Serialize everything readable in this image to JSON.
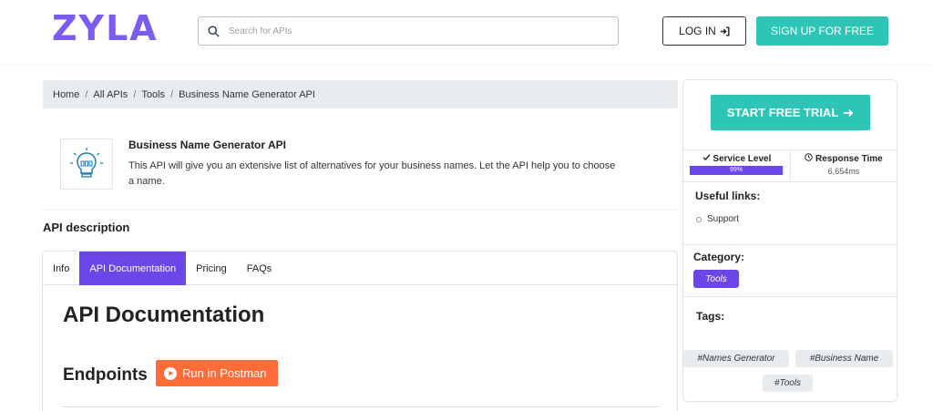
{
  "header": {
    "logo": "ZYLA",
    "search": {
      "placeholder": "Search for APIs",
      "value": ""
    },
    "login_label": "LOG IN",
    "signup_label": "SIGN UP FOR FREE"
  },
  "breadcrumb": [
    "Home",
    "All APIs",
    "Tools",
    "Business Name Generator API"
  ],
  "api": {
    "title": "Business Name Generator API",
    "description": "This API will give you an extensive list of alternatives for your business names. Let the API help you to choose a name."
  },
  "section_title": "API description",
  "tabs": [
    {
      "label": "Info",
      "active": false
    },
    {
      "label": "API Documentation",
      "active": true
    },
    {
      "label": "Pricing",
      "active": false
    },
    {
      "label": "FAQs",
      "active": false
    }
  ],
  "doc": {
    "heading": "API Documentation",
    "endpoints_heading": "Endpoints",
    "postman_label": "Run in Postman"
  },
  "sidebar": {
    "trial_label": "START FREE TRIAL",
    "service_level": {
      "label": "Service Level",
      "value": "99%",
      "fraction": 0.99
    },
    "response_time": {
      "label": "Response Time",
      "value": "6,654ms"
    },
    "useful_links_heading": "Useful links:",
    "links": [
      "Support"
    ],
    "category_heading": "Category:",
    "category": "Tools",
    "tags_heading": "Tags:",
    "tags": [
      "#Names Generator",
      "#Business Name",
      "#Tools"
    ]
  },
  "colors": {
    "brand": "#7b5cf0",
    "accent_purple": "#6c47e8",
    "teal": "#2ec4b6",
    "postman_orange": "#ff6c37"
  }
}
